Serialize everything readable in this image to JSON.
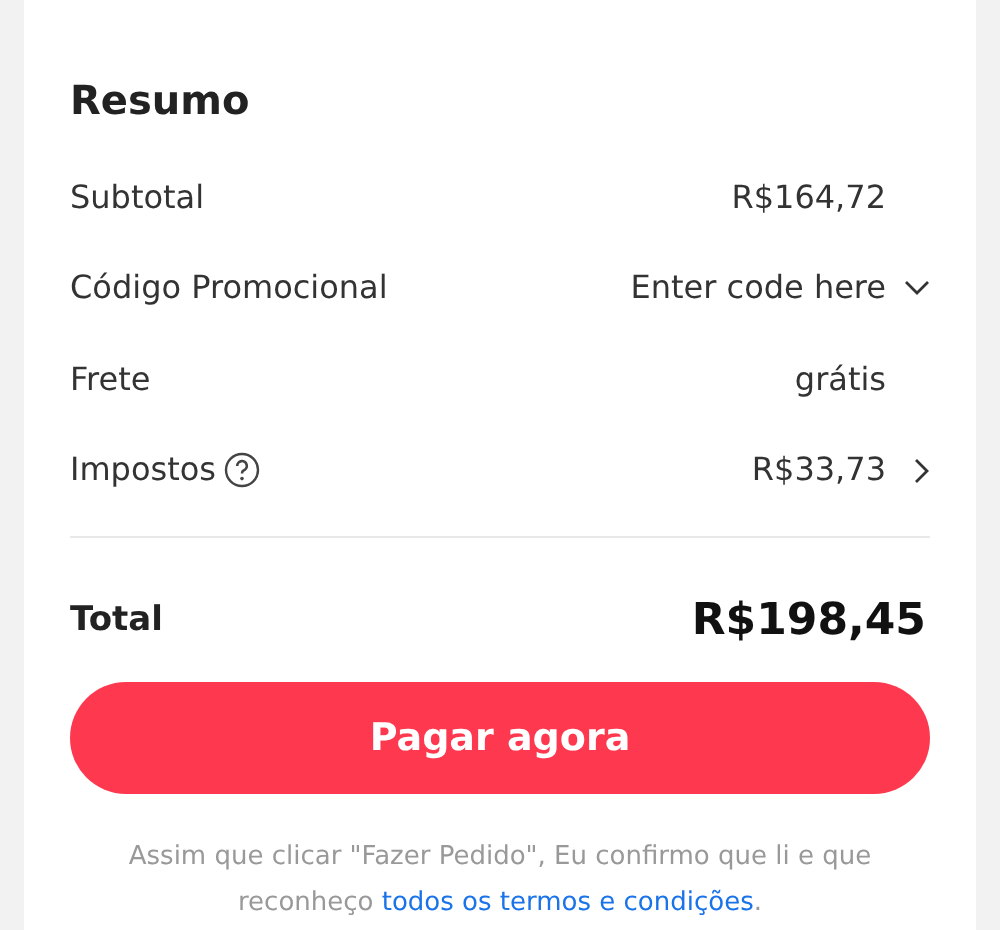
{
  "summary": {
    "title": "Resumo",
    "rows": [
      {
        "kind": "value",
        "label": "Subtotal",
        "value": "R$164,72"
      },
      {
        "kind": "dropdown",
        "label": "Código Promocional",
        "value": "Enter code here"
      },
      {
        "kind": "value",
        "label": "Frete",
        "value": "grátis"
      },
      {
        "kind": "details",
        "label": "Impostos",
        "value": "R$33,73"
      }
    ],
    "total": {
      "label": "Total",
      "value": "R$198,45"
    },
    "button": "Pagar agora",
    "note": {
      "text": "Assim que clicar \"Fazer Pedido\", Eu confirmo que li e que reconheço",
      "link": "todos os termos e condições",
      "end": "."
    }
  }
}
